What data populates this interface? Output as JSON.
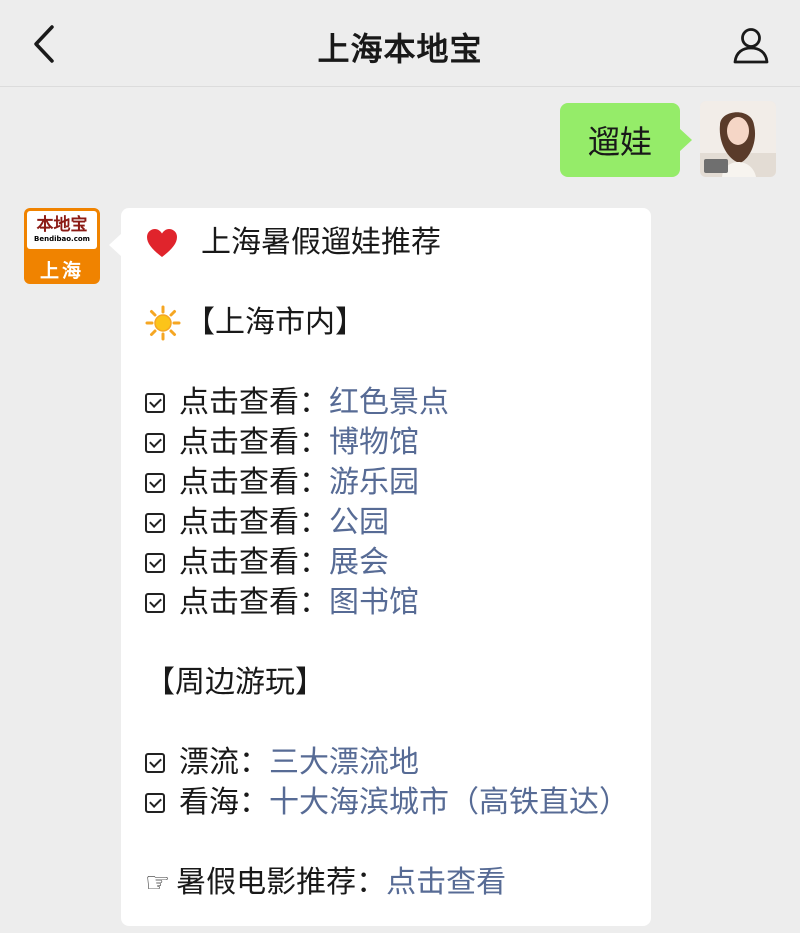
{
  "header": {
    "title": "上海本地宝",
    "back_icon": "chevron-left-icon",
    "profile_icon": "person-icon"
  },
  "outgoing": {
    "text": "遛娃",
    "bubble_color": "#95ec69"
  },
  "incoming": {
    "avatar": {
      "logo_name": "本地宝",
      "logo_url": "Bendibao.com",
      "city": "上海",
      "brand_color": "#f08300"
    },
    "title": "上海暑假遛娃推荐",
    "section_city": "【上海市内】",
    "city_items": [
      {
        "label": "点击查看：",
        "link": "红色景点"
      },
      {
        "label": "点击查看：",
        "link": "博物馆"
      },
      {
        "label": "点击查看：",
        "link": "游乐园"
      },
      {
        "label": "点击查看：",
        "link": "公园"
      },
      {
        "label": "点击查看：",
        "link": "展会"
      },
      {
        "label": "点击查看：",
        "link": "图书馆"
      }
    ],
    "section_nearby": "【周边游玩】",
    "nearby_items": [
      {
        "label": "漂流：",
        "link": "三大漂流地"
      },
      {
        "label": "看海：",
        "link": "十大海滨城市（高铁直达）"
      }
    ],
    "movie": {
      "label": "暑假电影推荐：",
      "link": "点击查看"
    },
    "link_color": "#576b95"
  }
}
